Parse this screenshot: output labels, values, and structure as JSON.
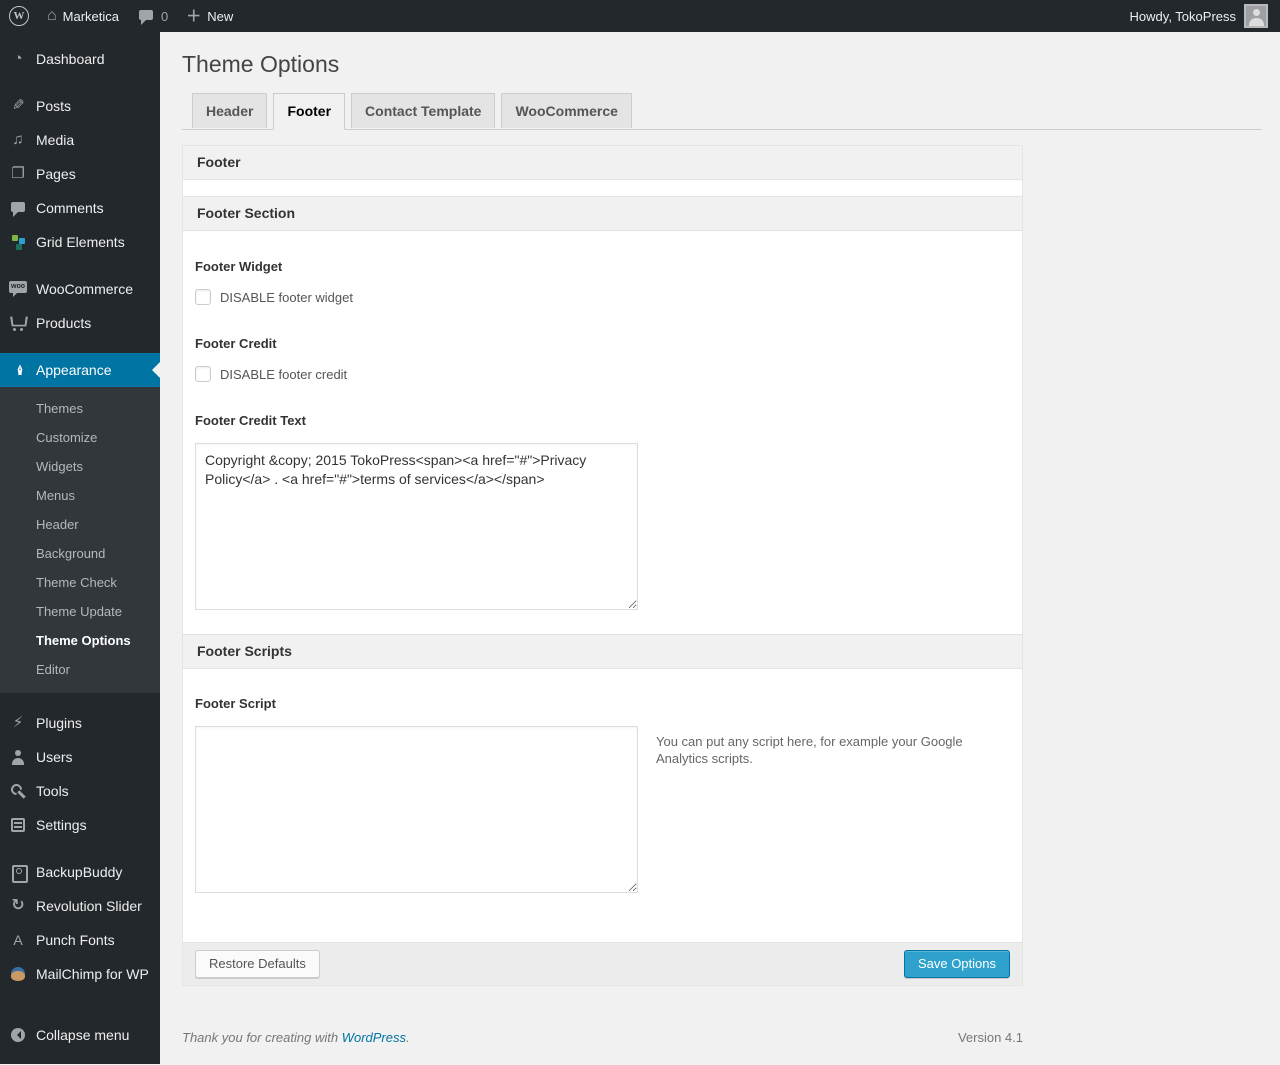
{
  "colors": {
    "admin_bar_bg": "#23282d",
    "sidebar_bg": "#23282d",
    "submenu_bg": "#32373c",
    "highlight_blue": "#0074a2",
    "primary_button": "#2ea2cc",
    "page_bg": "#f1f1f1"
  },
  "admin_bar": {
    "wp_logo": "W",
    "site_name": "Marketica",
    "comments_count": "0",
    "new_label": "New",
    "howdy": "Howdy, TokoPress"
  },
  "sidebar": {
    "items": [
      {
        "label": "Dashboard",
        "icon": "dashboard"
      },
      {
        "label": "Posts",
        "icon": "posts",
        "gap_before": true
      },
      {
        "label": "Media",
        "icon": "media"
      },
      {
        "label": "Pages",
        "icon": "pages"
      },
      {
        "label": "Comments",
        "icon": "comments"
      },
      {
        "label": "Grid Elements",
        "icon": "grid"
      },
      {
        "label": "WooCommerce",
        "icon": "woocommerce",
        "gap_before": true
      },
      {
        "label": "Products",
        "icon": "products"
      },
      {
        "label": "Appearance",
        "icon": "appearance",
        "gap_before": true,
        "active": true,
        "submenu": [
          {
            "label": "Themes"
          },
          {
            "label": "Customize"
          },
          {
            "label": "Widgets"
          },
          {
            "label": "Menus"
          },
          {
            "label": "Header"
          },
          {
            "label": "Background"
          },
          {
            "label": "Theme Check"
          },
          {
            "label": "Theme Update"
          },
          {
            "label": "Theme Options",
            "current": true
          },
          {
            "label": "Editor"
          }
        ]
      },
      {
        "label": "Plugins",
        "icon": "plugins",
        "gap_before": true
      },
      {
        "label": "Users",
        "icon": "users"
      },
      {
        "label": "Tools",
        "icon": "tools"
      },
      {
        "label": "Settings",
        "icon": "settings"
      },
      {
        "label": "BackupBuddy",
        "icon": "backupbuddy",
        "gap_before": true
      },
      {
        "label": "Revolution Slider",
        "icon": "revslider"
      },
      {
        "label": "Punch Fonts",
        "icon": "punchfonts"
      },
      {
        "label": "MailChimp for WP",
        "icon": "mailchimp"
      },
      {
        "label": "Collapse menu",
        "icon": "collapse",
        "collapse": true
      }
    ]
  },
  "page": {
    "title": "Theme Options",
    "tabs": [
      {
        "label": "Header"
      },
      {
        "label": "Footer",
        "active": true
      },
      {
        "label": "Contact Template"
      },
      {
        "label": "WooCommerce"
      }
    ]
  },
  "panel": {
    "header": "Footer",
    "section_footer": {
      "title": "Footer Section",
      "footer_widget_label": "Footer Widget",
      "footer_widget_checkbox": "DISABLE footer widget",
      "footer_widget_checked": false,
      "footer_credit_label": "Footer Credit",
      "footer_credit_checkbox": "DISABLE footer credit",
      "footer_credit_checked": false,
      "footer_credit_text_label": "Footer Credit Text",
      "footer_credit_text_value": "Copyright &copy; 2015 TokoPress<span><a href=\"#\">Privacy Policy</a> . <a href=\"#\">terms of services</a></span>"
    },
    "section_scripts": {
      "title": "Footer Scripts",
      "footer_script_label": "Footer Script",
      "footer_script_value": "",
      "footer_script_help": "You can put any script here, for example your Google Analytics scripts."
    },
    "actions": {
      "restore_label": "Restore Defaults",
      "save_label": "Save Options"
    }
  },
  "footer": {
    "thanks_prefix": "Thank you for creating with ",
    "wordpress_link": "WordPress",
    "thanks_suffix": ".",
    "version": "Version 4.1"
  }
}
